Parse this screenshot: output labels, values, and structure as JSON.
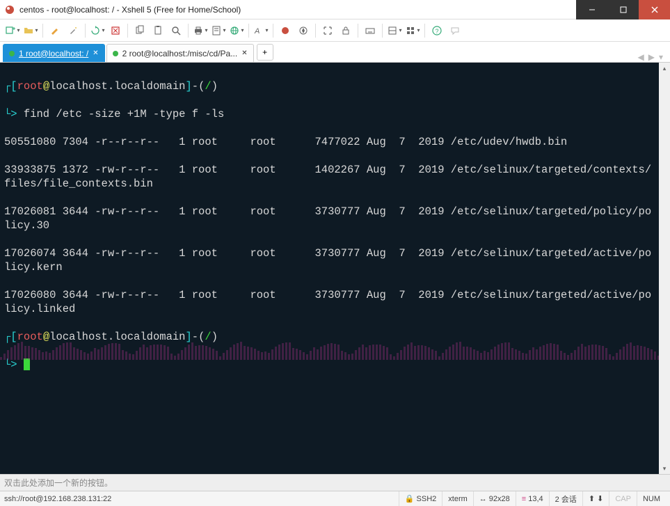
{
  "window": {
    "title": "centos - root@localhost: / - Xshell 5 (Free for Home/School)"
  },
  "tabs": {
    "active": {
      "label": "1 root@localhost: /"
    },
    "inactive": {
      "label": "2 root@localhost:/misc/cd/Pa..."
    },
    "add": "+"
  },
  "prompt1": {
    "lb": "┌[",
    "user": "root",
    "at": "@",
    "host": "localhost.localdomain",
    "rb": "]",
    "dash": "-(",
    "path": "/",
    "close": ")",
    "caret": "└> "
  },
  "cmd": "find /etc -size +1M -type f -ls",
  "out": [
    "50551080 7304 -r--r--r--   1 root     root      7477022 Aug  7  2019 /etc/udev/hwdb.bin",
    "33933875 1372 -rw-r--r--   1 root     root      1402267 Aug  7  2019 /etc/selinux/targeted/contexts/files/file_contexts.bin",
    "17026081 3644 -rw-r--r--   1 root     root      3730777 Aug  7  2019 /etc/selinux/targeted/policy/policy.30",
    "17026074 3644 -rw-r--r--   1 root     root      3730777 Aug  7  2019 /etc/selinux/targeted/active/policy.kern",
    "17026080 3644 -rw-r--r--   1 root     root      3730777 Aug  7  2019 /etc/selinux/targeted/active/policy.linked"
  ],
  "footer": {
    "hint": "双击此处添加一个新的按钮。"
  },
  "status": {
    "conn": "ssh://root@192.168.238.131:22",
    "lock": "🔒",
    "proto": "SSH2",
    "term": "xterm",
    "size": "92x28",
    "pos": "13,4",
    "sess": "2 会话",
    "arrows": "⬆ ⬇",
    "caps": "CAP",
    "num": "NUM"
  }
}
